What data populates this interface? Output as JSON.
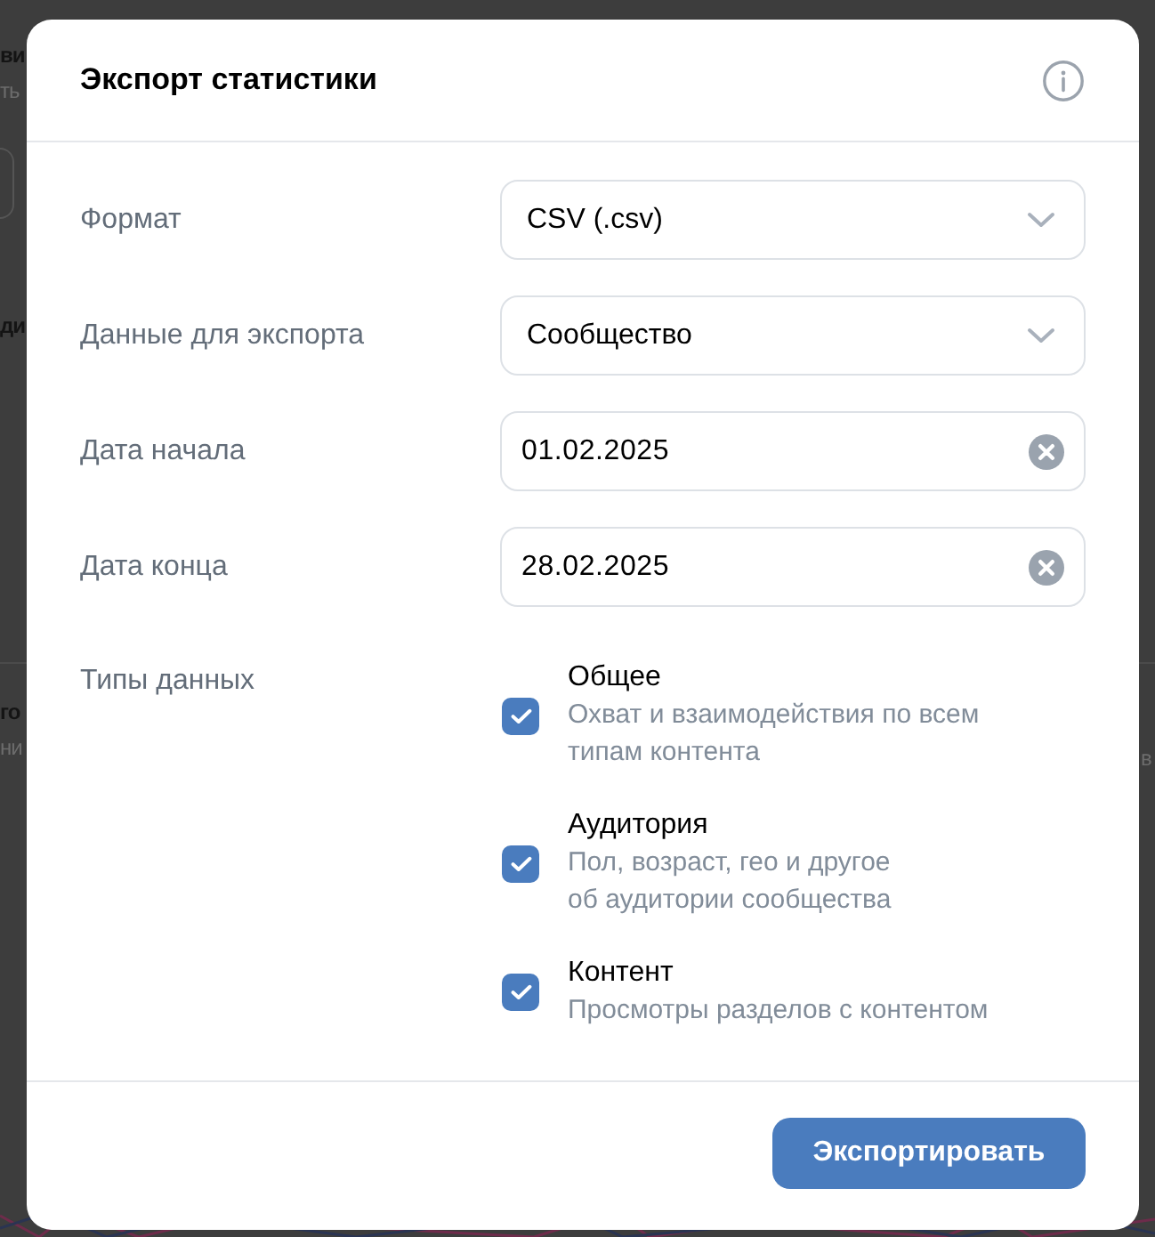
{
  "background": {
    "left_texts": [
      {
        "text": "ви",
        "kind": "heading"
      },
      {
        "text": "ть",
        "kind": "caption"
      },
      {
        "text": "ди",
        "kind": "heading"
      },
      {
        "text": "го",
        "kind": "heading"
      },
      {
        "text": "ни",
        "kind": "caption"
      }
    ],
    "right_texts": [
      {
        "text": "в",
        "kind": "caption"
      }
    ]
  },
  "dialog": {
    "title": "Экспорт статистики",
    "fields": [
      {
        "label": "Формат",
        "kind": "select",
        "value": "CSV (.csv)"
      },
      {
        "label": "Данные для экспорта",
        "kind": "select",
        "value": "Сообщество"
      },
      {
        "label": "Дата начала",
        "kind": "date",
        "value": "01.02.2025"
      },
      {
        "label": "Дата конца",
        "kind": "date",
        "value": "28.02.2025"
      }
    ],
    "data_types": {
      "label": "Типы данных",
      "options": [
        {
          "title": "Общее",
          "description": "Охват и взаимодействия по всем\nтипам контента",
          "checked": true
        },
        {
          "title": "Аудитория",
          "description": "Пол, возраст, гео и другое\nоб аудитории сообщества",
          "checked": true
        },
        {
          "title": "Контент",
          "description": "Просмотры разделов с контентом",
          "checked": true
        }
      ]
    },
    "export_button": "Экспортировать"
  }
}
